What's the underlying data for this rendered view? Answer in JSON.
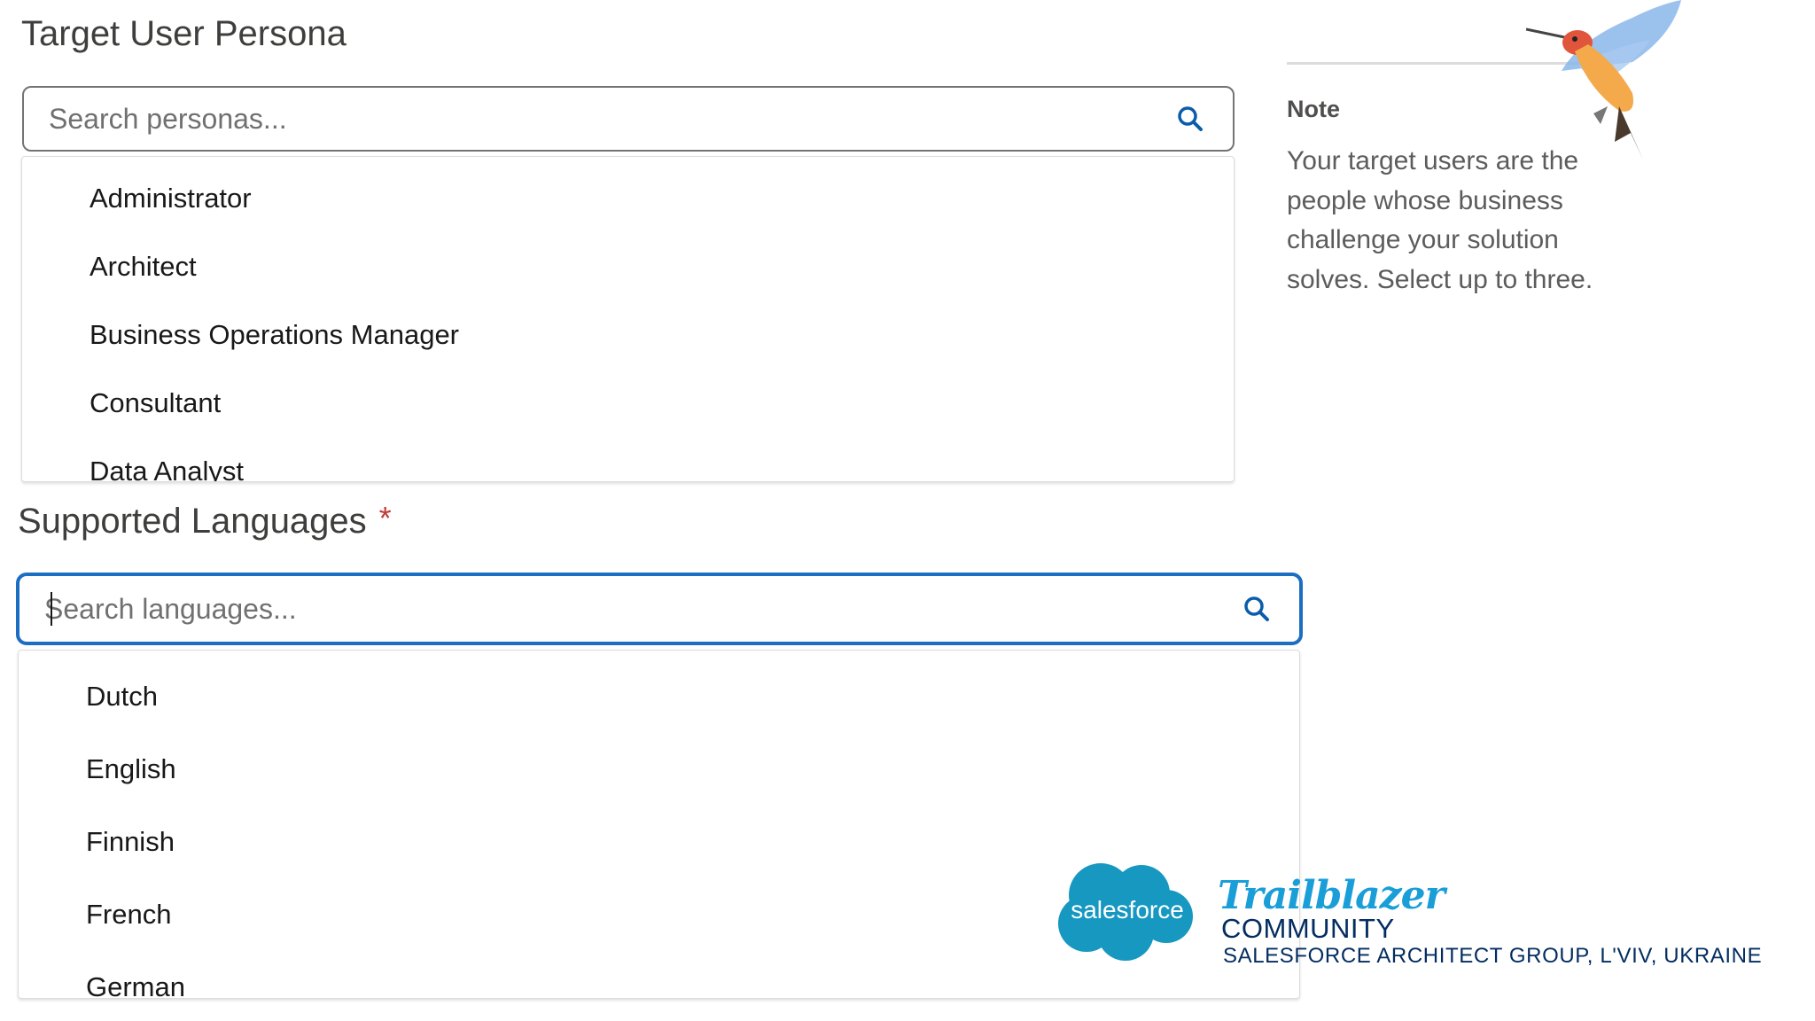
{
  "persona": {
    "title": "Target User Persona",
    "search_placeholder": "Search personas...",
    "options": [
      "Administrator",
      "Architect",
      "Business Operations Manager",
      "Consultant",
      "Data Analyst"
    ]
  },
  "languages": {
    "title": "Supported Languages",
    "required_marker": "*",
    "search_placeholder": "Search languages...",
    "options": [
      "Dutch",
      "English",
      "Finnish",
      "French",
      "German"
    ]
  },
  "note": {
    "label": "Note",
    "text": "Your target users are the people whose business challenge your solution solves. Select up to three."
  },
  "branding": {
    "salesforce_logo_text": "salesforce",
    "trailblazer_title": "Trailblazer",
    "community": "COMMUNITY",
    "group": "SALESFORCE ARCHITECT GROUP, L'VIV, UKRAINE"
  },
  "colors": {
    "focus_blue": "#1b6ec2",
    "icon_blue": "#0b5cab",
    "required_red": "#c23934",
    "salesforce_blue": "#1798c1",
    "trailblazer_blue": "#1a9ed8",
    "community_navy": "#032d60"
  },
  "icons": {
    "search": "search-icon",
    "mascot": "hummingbird-icon"
  }
}
